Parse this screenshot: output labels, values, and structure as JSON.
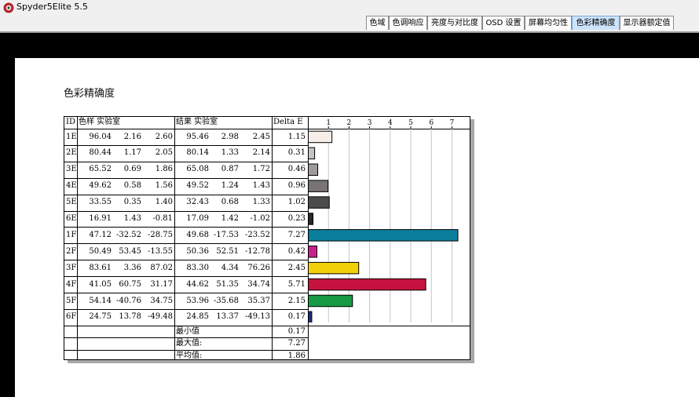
{
  "app": {
    "title": "Spyder5Elite 5.5",
    "icon": "spyder-logo-icon"
  },
  "tabs": [
    {
      "label": "色域",
      "active": false
    },
    {
      "label": "色调响应",
      "active": false
    },
    {
      "label": "亮度与对比度",
      "active": false
    },
    {
      "label": "OSD 设置",
      "active": false
    },
    {
      "label": "屏幕均匀性",
      "active": false
    },
    {
      "label": "色彩精确度",
      "active": true
    },
    {
      "label": "显示器额定值",
      "active": false
    }
  ],
  "page": {
    "heading": "色彩精确度"
  },
  "table": {
    "headers": {
      "id": "ID",
      "sample": "色样 实验室",
      "result": "结果 实验室",
      "delta": "Delta E"
    },
    "rows": [
      {
        "id": "1E",
        "sample": [
          "96.04",
          "2.16",
          "2.60"
        ],
        "result": [
          "95.46",
          "2.98",
          "2.45"
        ],
        "delta": "1.15",
        "color": "#f7ede9"
      },
      {
        "id": "2E",
        "sample": [
          "80.44",
          "1.17",
          "2.05"
        ],
        "result": [
          "80.14",
          "1.33",
          "2.14"
        ],
        "delta": "0.31",
        "color": "#c6c2c1"
      },
      {
        "id": "3E",
        "sample": [
          "65.52",
          "0.69",
          "1.86"
        ],
        "result": [
          "65.08",
          "0.87",
          "1.72"
        ],
        "delta": "0.46",
        "color": "#9d9a99"
      },
      {
        "id": "4E",
        "sample": [
          "49.62",
          "0.58",
          "1.56"
        ],
        "result": [
          "49.52",
          "1.24",
          "1.43"
        ],
        "delta": "0.96",
        "color": "#777473"
      },
      {
        "id": "5E",
        "sample": [
          "33.55",
          "0.35",
          "1.40"
        ],
        "result": [
          "32.43",
          "0.68",
          "1.33"
        ],
        "delta": "1.02",
        "color": "#4d4b4a"
      },
      {
        "id": "6E",
        "sample": [
          "16.91",
          "1.43",
          "-0.81"
        ],
        "result": [
          "17.09",
          "1.42",
          "-1.02"
        ],
        "delta": "0.23",
        "color": "#2a2828"
      },
      {
        "id": "1F",
        "sample": [
          "47.12",
          "-32.52",
          "-28.75"
        ],
        "result": [
          "49.68",
          "-17.53",
          "-23.52"
        ],
        "delta": "7.27",
        "color": "#0a7e9a"
      },
      {
        "id": "2F",
        "sample": [
          "50.49",
          "53.45",
          "-13.55"
        ],
        "result": [
          "50.36",
          "52.51",
          "-12.78"
        ],
        "delta": "0.42",
        "color": "#c8208a"
      },
      {
        "id": "3F",
        "sample": [
          "83.61",
          "3.36",
          "87.02"
        ],
        "result": [
          "83.30",
          "4.34",
          "76.26"
        ],
        "delta": "2.45",
        "color": "#f2d10a"
      },
      {
        "id": "4F",
        "sample": [
          "41.05",
          "60.75",
          "31.17"
        ],
        "result": [
          "44.62",
          "51.35",
          "34.74"
        ],
        "delta": "5.71",
        "color": "#c6123f"
      },
      {
        "id": "5F",
        "sample": [
          "54.14",
          "-40.76",
          "34.75"
        ],
        "result": [
          "53.96",
          "-35.68",
          "35.37"
        ],
        "delta": "2.15",
        "color": "#169a44"
      },
      {
        "id": "6F",
        "sample": [
          "24.75",
          "13.78",
          "-49.48"
        ],
        "result": [
          "24.85",
          "13.37",
          "-49.13"
        ],
        "delta": "0.17",
        "color": "#1e2d78"
      }
    ],
    "summary": [
      {
        "label": "最小值",
        "value": "0.17"
      },
      {
        "label": "最大值:",
        "value": "7.27"
      },
      {
        "label": "平均值:",
        "value": "1.86"
      }
    ]
  },
  "chart_data": {
    "type": "bar",
    "orientation": "horizontal",
    "categories": [
      "1E",
      "2E",
      "3E",
      "4E",
      "5E",
      "6E",
      "1F",
      "2F",
      "3F",
      "4F",
      "5F",
      "6F"
    ],
    "values": [
      1.15,
      0.31,
      0.46,
      0.96,
      1.02,
      0.23,
      7.27,
      0.42,
      2.45,
      5.71,
      2.15,
      0.17
    ],
    "colors": [
      "#f7ede9",
      "#c6c2c1",
      "#9d9a99",
      "#777473",
      "#4d4b4a",
      "#2a2828",
      "#0a7e9a",
      "#c8208a",
      "#f2d10a",
      "#c6123f",
      "#169a44",
      "#1e2d78"
    ],
    "xticks": [
      "1",
      "2",
      "3",
      "4",
      "5",
      "6",
      "7"
    ],
    "xlim": [
      0,
      7.9
    ],
    "grid": true
  }
}
